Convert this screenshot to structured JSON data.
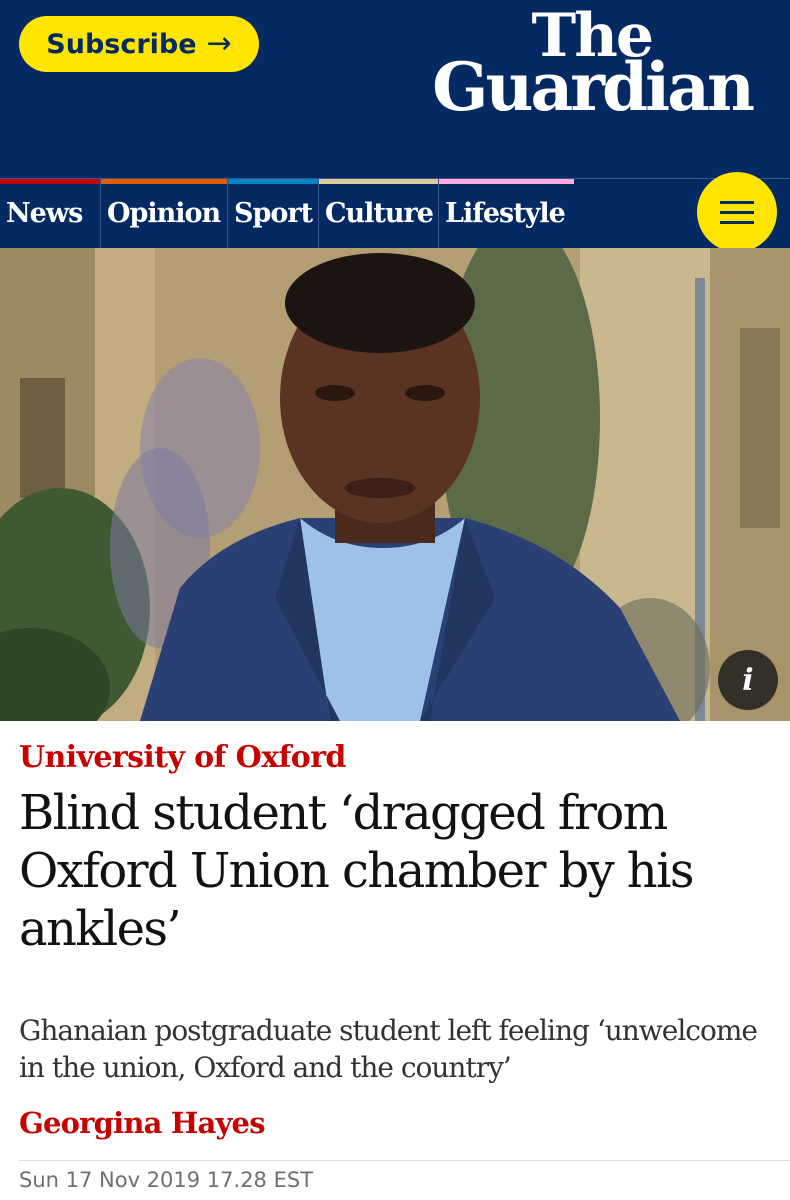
{
  "header": {
    "subscribe_label": "Subscribe",
    "logo_line1": "The",
    "logo_line2": "Guardian",
    "brand_color": "#052962",
    "accent_color": "#ffe500"
  },
  "nav": {
    "items": [
      {
        "label": "News",
        "color": "#c70000"
      },
      {
        "label": "Opinion",
        "color": "#e05e00"
      },
      {
        "label": "Sport",
        "color": "#0084c6"
      },
      {
        "label": "Culture",
        "color": "#a1845c"
      },
      {
        "label": "Lifestyle",
        "color": "#bb3b80"
      }
    ],
    "menu_icon": "hamburger-icon"
  },
  "hero": {
    "info_label": "i"
  },
  "article": {
    "kicker": "University of Oxford",
    "headline": "Blind student ‘dragged from Oxford Union chamber by his ankles’",
    "standfirst": "Ghanaian postgraduate student left feeling ‘unwelcome in the union, Oxford and the country’",
    "byline": "Georgina Hayes",
    "dateline": "Sun 17 Nov 2019 17.28 EST",
    "kicker_color": "#c70000"
  }
}
